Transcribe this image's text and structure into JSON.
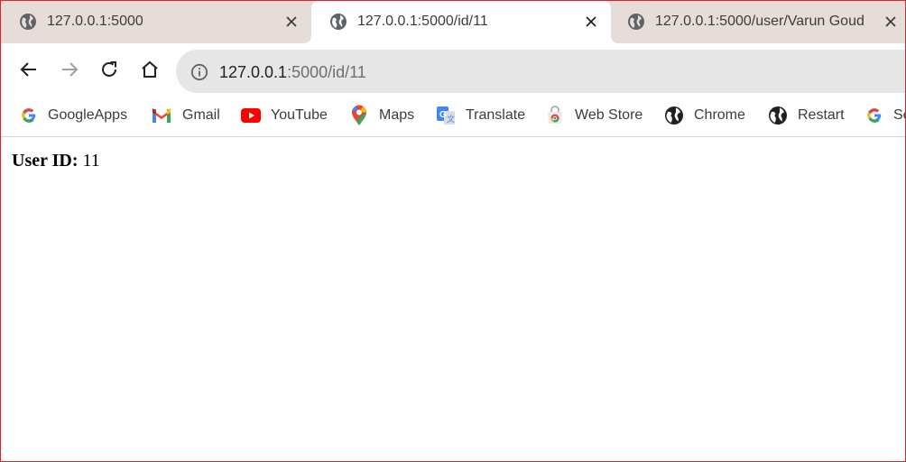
{
  "tabs": [
    {
      "title": "127.0.0.1:5000",
      "active": false
    },
    {
      "title": "127.0.0.1:5000/id/11",
      "active": true
    },
    {
      "title": "127.0.0.1:5000/user/Varun Goud",
      "active": false
    }
  ],
  "omnibox": {
    "url_host": "127.0.0.1",
    "url_rest": ":5000/id/11"
  },
  "bookmarks": [
    {
      "label": "GoogleApps",
      "icon": "google-icon"
    },
    {
      "label": "Gmail",
      "icon": "gmail-icon"
    },
    {
      "label": "YouTube",
      "icon": "youtube-icon"
    },
    {
      "label": "Maps",
      "icon": "maps-pin-icon"
    },
    {
      "label": "Translate",
      "icon": "translate-icon"
    },
    {
      "label": "Web Store",
      "icon": "web-store-icon"
    },
    {
      "label": "Chrome",
      "icon": "globe-icon"
    },
    {
      "label": "Restart",
      "icon": "globe-icon"
    },
    {
      "label": "Se",
      "icon": "google-icon"
    }
  ],
  "page": {
    "label": "User ID:",
    "value": "11"
  },
  "colors": {
    "tabstrip_bg": "#e6ddd9",
    "omnibox_bg": "#e6e6e6",
    "frame_border": "#e0242b"
  }
}
